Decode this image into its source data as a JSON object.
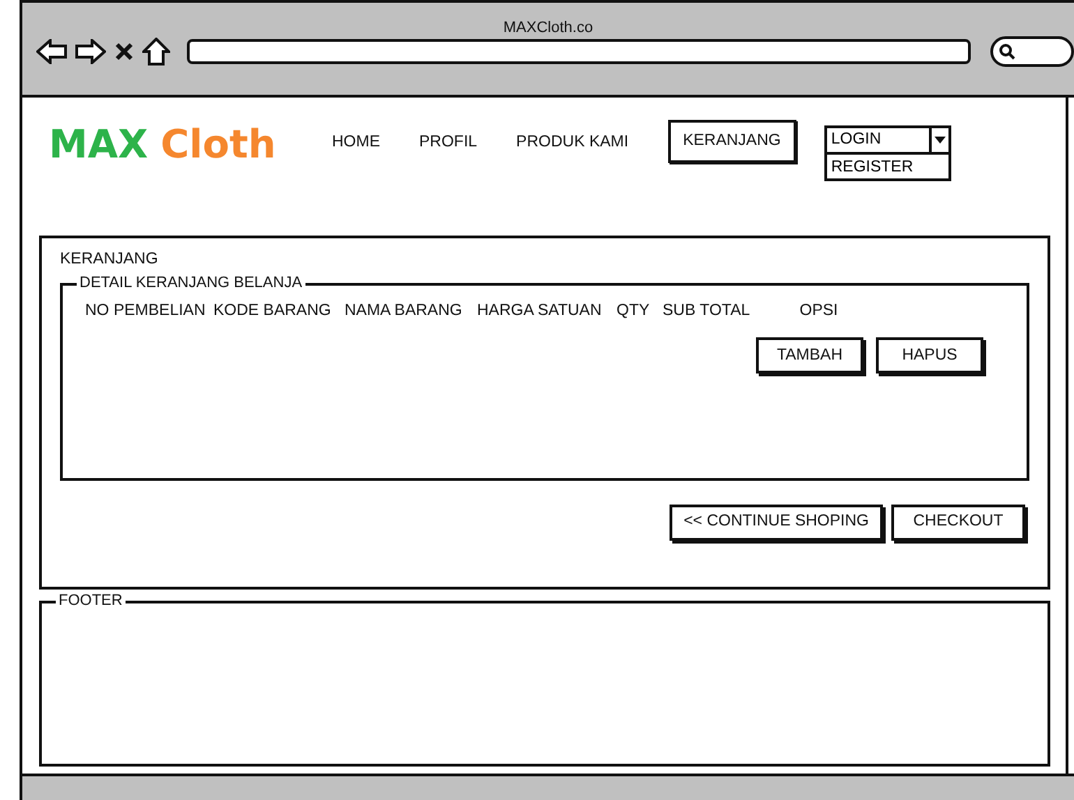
{
  "browser": {
    "title": "MAXCloth.co"
  },
  "logo": {
    "part_1": "MAX",
    "part_2": "Cloth"
  },
  "nav": [
    {
      "label": "HOME",
      "selected": false
    },
    {
      "label": "PROFIL",
      "selected": false
    },
    {
      "label": "PRODUK KAMI",
      "selected": false
    },
    {
      "label": "KERANJANG",
      "selected": true
    }
  ],
  "account_menu": {
    "value": "LOGIN",
    "options": [
      "REGISTER"
    ]
  },
  "cart": {
    "title": "KERANJANG",
    "group_title": "DETAIL KERANJANG BELANJA",
    "columns": [
      "NO PEMBELIAN",
      "KODE BARANG",
      "NAMA BARANG",
      "HARGA SATUAN",
      "QTY",
      "SUB TOTAL",
      "OPSI"
    ],
    "row_buttons": [
      "TAMBAH",
      "HAPUS"
    ],
    "actions": [
      "<< CONTINUE SHOPING",
      "CHECKOUT"
    ]
  },
  "footer": {
    "title": "FOOTER"
  }
}
